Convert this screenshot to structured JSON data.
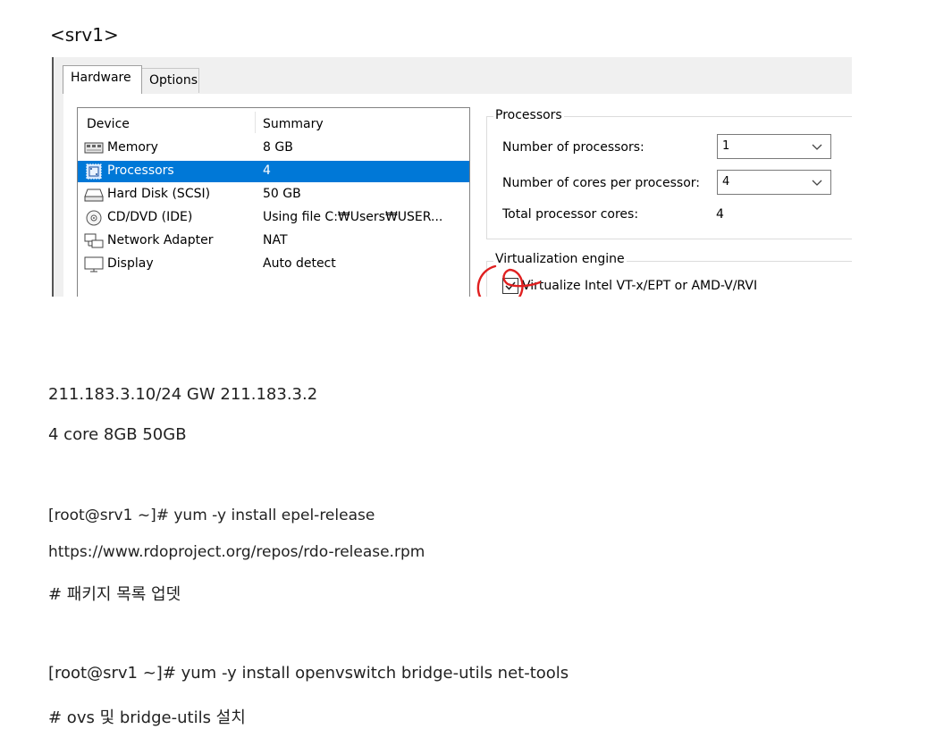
{
  "heading": "<srv1>",
  "vm_settings": {
    "tabs": [
      {
        "label": "Hardware"
      },
      {
        "label": "Options"
      }
    ],
    "device_list": {
      "headers": {
        "device": "Device",
        "summary": "Summary"
      },
      "rows": [
        {
          "icon": "memory-icon",
          "device": "Memory",
          "summary": "8 GB"
        },
        {
          "icon": "processor-icon",
          "device": "Processors",
          "summary": "4",
          "selected": true
        },
        {
          "icon": "hard-disk-icon",
          "device": "Hard Disk (SCSI)",
          "summary": "50 GB"
        },
        {
          "icon": "cd-dvd-icon",
          "device": "CD/DVD (IDE)",
          "summary": "Using file C:₩Users₩USER..."
        },
        {
          "icon": "network-adapter-icon",
          "device": "Network Adapter",
          "summary": "NAT"
        },
        {
          "icon": "display-icon",
          "device": "Display",
          "summary": "Auto detect"
        }
      ]
    },
    "processors": {
      "group_label": "Processors",
      "num_processors_label": "Number of processors:",
      "num_processors_value": "1",
      "cores_label": "Number of cores per processor:",
      "cores_value": "4",
      "total_label": "Total processor cores:",
      "total_value": "4"
    },
    "virtualization": {
      "group_label": "Virtualization engine",
      "checkbox_label": "Virtualize Intel VT-x/EPT or AMD-V/RVI",
      "checked": true,
      "annotation_color": "#e02020"
    },
    "selection_color": "#0078d7"
  },
  "notes": {
    "network": "211.183.3.10/24 GW 211.183.3.2",
    "specs": "4 core 8GB 50GB",
    "cmd1": "[root@srv1 ~]# yum -y install epel-release",
    "url1": "https://www.rdoproject.org/repos/rdo-release.rpm",
    "comment1": "# 패키지 목록 업뎃",
    "cmd2": "[root@srv1 ~]# yum -y install openvswitch bridge-utils net-tools",
    "comment2": "# ovs 및 bridge-utils 설치"
  }
}
